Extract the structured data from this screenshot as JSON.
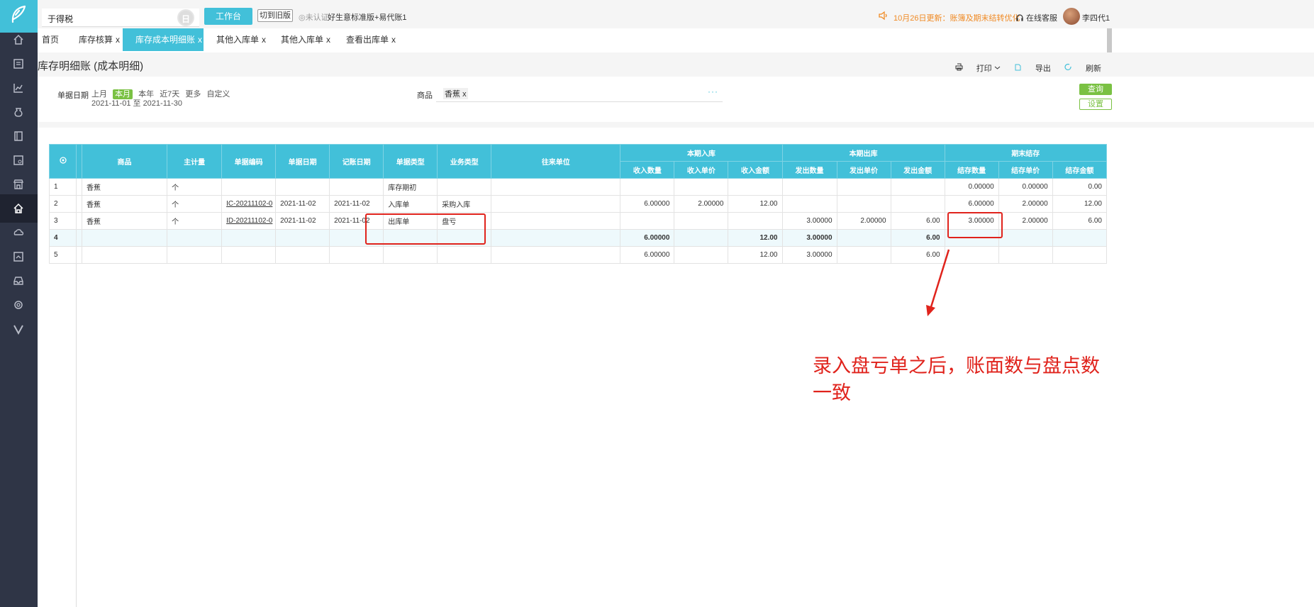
{
  "topbar": {
    "company": "于得税",
    "circle_label": "日",
    "workbench": "工作台",
    "switch_old": "切到旧版",
    "unverified": "未认证",
    "plan": "好生意标准版+易代账1",
    "notice": "10月26日更新：账簿及期末结转优化",
    "service": "在线客服",
    "username": "李四代1"
  },
  "tabs": [
    {
      "label": "首页",
      "closable": false
    },
    {
      "label": "库存核算",
      "closable": true
    },
    {
      "label": "库存成本明细账",
      "closable": true,
      "active": true
    },
    {
      "label": "其他入库单",
      "closable": true
    },
    {
      "label": "其他入库单",
      "closable": true
    },
    {
      "label": "查看出库单",
      "closable": true
    }
  ],
  "tab_close": "x",
  "page": {
    "title": "库存明细账 (成本明细)",
    "print": "打印",
    "export": "导出",
    "refresh": "刷新"
  },
  "filter": {
    "date_label": "单据日期",
    "date_options": [
      "上月",
      "本月",
      "本年",
      "近7天",
      "更多",
      "自定义"
    ],
    "date_selected": "本月",
    "date_range": "2021-11-01 至 2021-11-30",
    "product_label": "商品",
    "product_tag": "香蕉",
    "product_tag_close": "x",
    "more": "···",
    "query": "查询",
    "settings": "设置"
  },
  "table": {
    "headers": {
      "product": "商品",
      "unit": "主计量",
      "doc_no": "单据编码",
      "doc_date": "单据日期",
      "post_date": "记账日期",
      "doc_type": "单据类型",
      "biz_type": "业务类型",
      "partner": "往来单位",
      "in_group": "本期入库",
      "out_group": "本期出库",
      "end_group": "期末结存",
      "in_qty": "收入数量",
      "in_price": "收入单价",
      "in_amt": "收入金额",
      "out_qty": "发出数量",
      "out_price": "发出单价",
      "out_amt": "发出金额",
      "end_qty": "结存数量",
      "end_price": "结存单价",
      "end_amt": "结存金额"
    },
    "rows": [
      {
        "idx": "1",
        "product": "香蕉",
        "unit": "个",
        "doc_no": "",
        "doc_date": "",
        "post_date": "",
        "doc_type": "库存期初",
        "biz_type": "",
        "partner": "",
        "in_qty": "",
        "in_price": "",
        "in_amt": "",
        "out_qty": "",
        "out_price": "",
        "out_amt": "",
        "end_qty": "0.00000",
        "end_price": "0.00000",
        "end_amt": "0.00"
      },
      {
        "idx": "2",
        "product": "香蕉",
        "unit": "个",
        "doc_no": "IC-20211102-0",
        "doc_date": "2021-11-02",
        "post_date": "2021-11-02",
        "doc_type": "入库单",
        "biz_type": "采购入库",
        "partner": "",
        "in_qty": "6.00000",
        "in_price": "2.00000",
        "in_amt": "12.00",
        "out_qty": "",
        "out_price": "",
        "out_amt": "",
        "end_qty": "6.00000",
        "end_price": "2.00000",
        "end_amt": "12.00"
      },
      {
        "idx": "3",
        "product": "香蕉",
        "unit": "个",
        "doc_no": "ID-20211102-0",
        "doc_date": "2021-11-02",
        "post_date": "2021-11-02",
        "doc_type": "出库单",
        "biz_type": "盘亏",
        "partner": "",
        "in_qty": "",
        "in_price": "",
        "in_amt": "",
        "out_qty": "3.00000",
        "out_price": "2.00000",
        "out_amt": "6.00",
        "end_qty": "3.00000",
        "end_price": "2.00000",
        "end_amt": "6.00"
      },
      {
        "idx": "4",
        "product": "",
        "unit": "",
        "doc_no": "",
        "doc_date": "",
        "post_date": "",
        "doc_type": "",
        "biz_type": "",
        "partner": "",
        "in_qty": "6.00000",
        "in_price": "",
        "in_amt": "12.00",
        "out_qty": "3.00000",
        "out_price": "",
        "out_amt": "6.00",
        "end_qty": "",
        "end_price": "",
        "end_amt": ""
      },
      {
        "idx": "5",
        "product": "",
        "unit": "",
        "doc_no": "",
        "doc_date": "",
        "post_date": "",
        "doc_type": "",
        "biz_type": "",
        "partner": "",
        "in_qty": "6.00000",
        "in_price": "",
        "in_amt": "12.00",
        "out_qty": "3.00000",
        "out_price": "",
        "out_amt": "6.00",
        "end_qty": "",
        "end_price": "",
        "end_amt": ""
      }
    ]
  },
  "annotation": "录入盘亏单之后，账面数与盘点数一致",
  "colors": {
    "accent": "#42c0d9",
    "green": "#7ac143",
    "sidebar": "#2f3546",
    "annotation_red": "#e0231c",
    "notice_orange": "#f08a24"
  }
}
